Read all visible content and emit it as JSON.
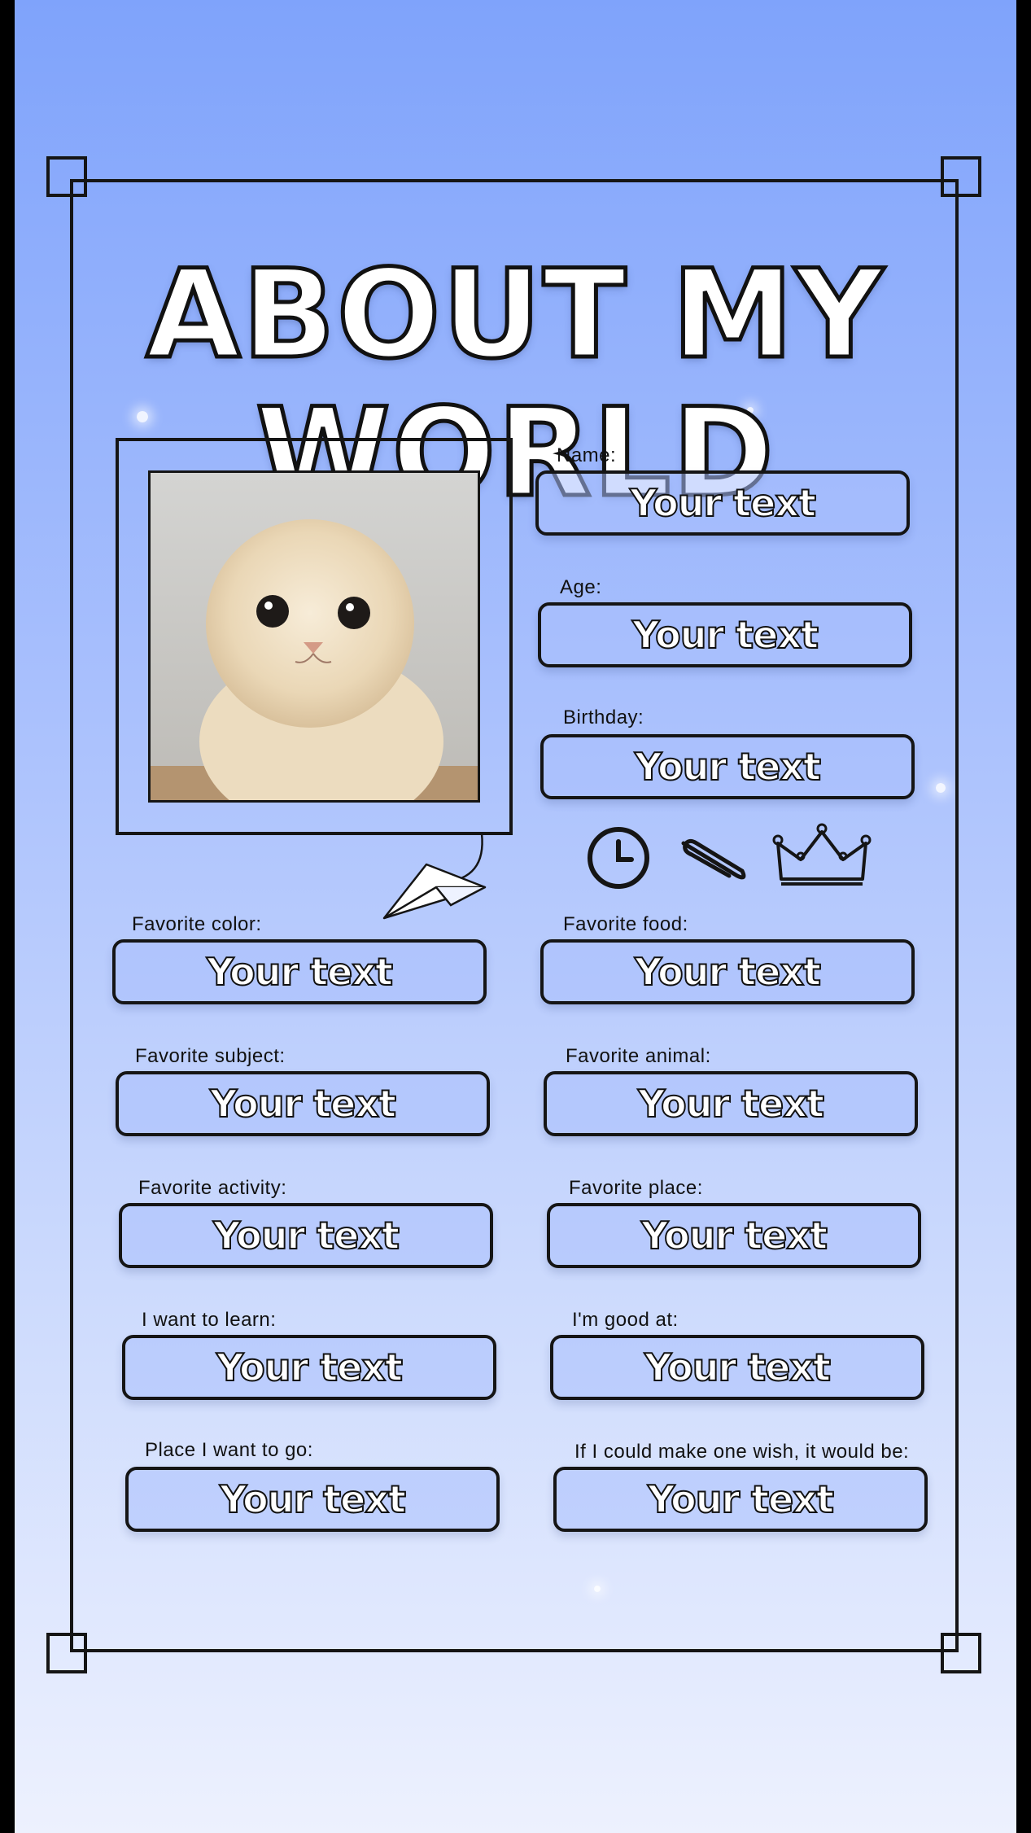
{
  "title": "ABOUT MY WORLD",
  "placeholder": "Your text",
  "left_fields": [
    {
      "label": "Favorite color:"
    },
    {
      "label": "Favorite subject:"
    },
    {
      "label": "Favorite activity:"
    },
    {
      "label": "I want to learn:"
    },
    {
      "label": "Place I want to go:"
    }
  ],
  "right_fields": [
    {
      "label": "Name:"
    },
    {
      "label": "Age:"
    },
    {
      "label": "Birthday:"
    },
    {
      "label": "Favorite food:"
    },
    {
      "label": "Favorite animal:"
    },
    {
      "label": "Favorite place:"
    },
    {
      "label": "I'm good at:"
    },
    {
      "label": "If I could make one wish, it would be:"
    }
  ],
  "decorations": [
    "clock-icon",
    "paperclip-icon",
    "crown-icon",
    "paper-plane-icon"
  ],
  "colors": {
    "accent_outline": "#151515",
    "field_fill": "#aac0fd",
    "background_top": "#7fa3fb",
    "background_bottom": "#edf1fe"
  }
}
